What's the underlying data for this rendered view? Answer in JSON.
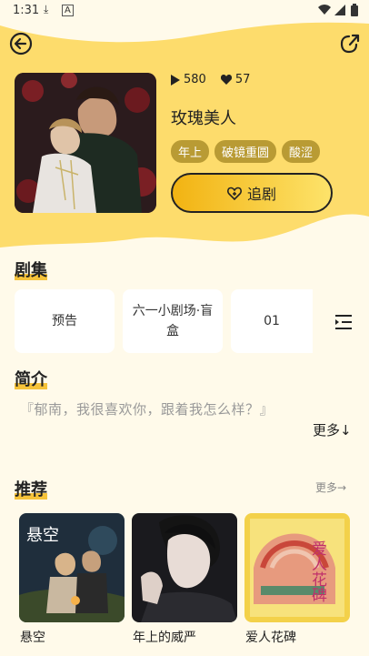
{
  "status_bar": {
    "time": "1:31",
    "icons": [
      "download-icon",
      "text-a-icon",
      "wifi-icon",
      "signal-icon",
      "battery-icon"
    ]
  },
  "header": {
    "back_icon": "back-arrow-icon",
    "share_icon": "share-icon"
  },
  "drama": {
    "plays": "580",
    "likes": "57",
    "title": "玫瑰美人",
    "tags": [
      "年上",
      "破镜重圆",
      "酸涩"
    ],
    "follow_label": "追剧"
  },
  "episodes": {
    "section_title": "剧集",
    "items": [
      "预告",
      "六一小剧场·盲盒",
      "01"
    ]
  },
  "intro": {
    "section_title": "简介",
    "text": "『郁南，我很喜欢你，跟着我怎么样？』",
    "more_label": "更多↓"
  },
  "recommend": {
    "section_title": "推荐",
    "more_label": "更多→",
    "items": [
      {
        "title": "悬空",
        "cover_text": "悬空"
      },
      {
        "title": "年上的威严"
      },
      {
        "title": "爱人花碑",
        "cover_text": "爱人花碑"
      }
    ]
  },
  "colors": {
    "accent": "#f6c33a",
    "tag_bg": "#b99b34",
    "page_bg": "#fffaea"
  }
}
